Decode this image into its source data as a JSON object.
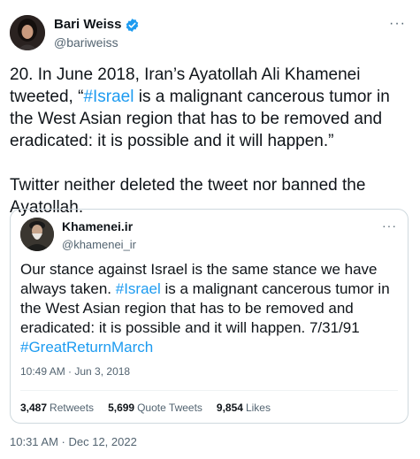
{
  "author": {
    "name": "Bari Weiss",
    "handle": "@bariweiss"
  },
  "more_label": "···",
  "body": {
    "part1": "20. In June 2018, Iran’s Ayatollah Ali Khamenei tweeted, “",
    "hashtag": "#Israel",
    "part2": " is a malignant cancerous tumor in the West Asian region that has to be removed and eradicated: it is possible and it will happen.”\n\nTwitter neither deleted the tweet nor banned the Ayatollah."
  },
  "quote": {
    "name": "Khamenei.ir",
    "handle": "@khamenei_ir",
    "text_part1": "Our stance against Israel is the same stance we have always taken. ",
    "hashtag1": "#Israel",
    "text_part2": " is a malignant cancerous tumor in the West Asian region that has to be removed and eradicated: it is possible and it will happen. 7/31/91 ",
    "hashtag2": "#GreatReturnMarch",
    "timestamp": "10:49 AM · Jun 3, 2018",
    "stats": {
      "retweets_count": "3,487",
      "retweets_label": "Retweets",
      "quotes_count": "5,699",
      "quotes_label": "Quote Tweets",
      "likes_count": "9,854",
      "likes_label": "Likes"
    }
  },
  "timestamp": "10:31 AM · Dec 12, 2022",
  "colors": {
    "link": "#1d9bf0",
    "secondary_text": "#536471",
    "border": "#cfd9de"
  }
}
